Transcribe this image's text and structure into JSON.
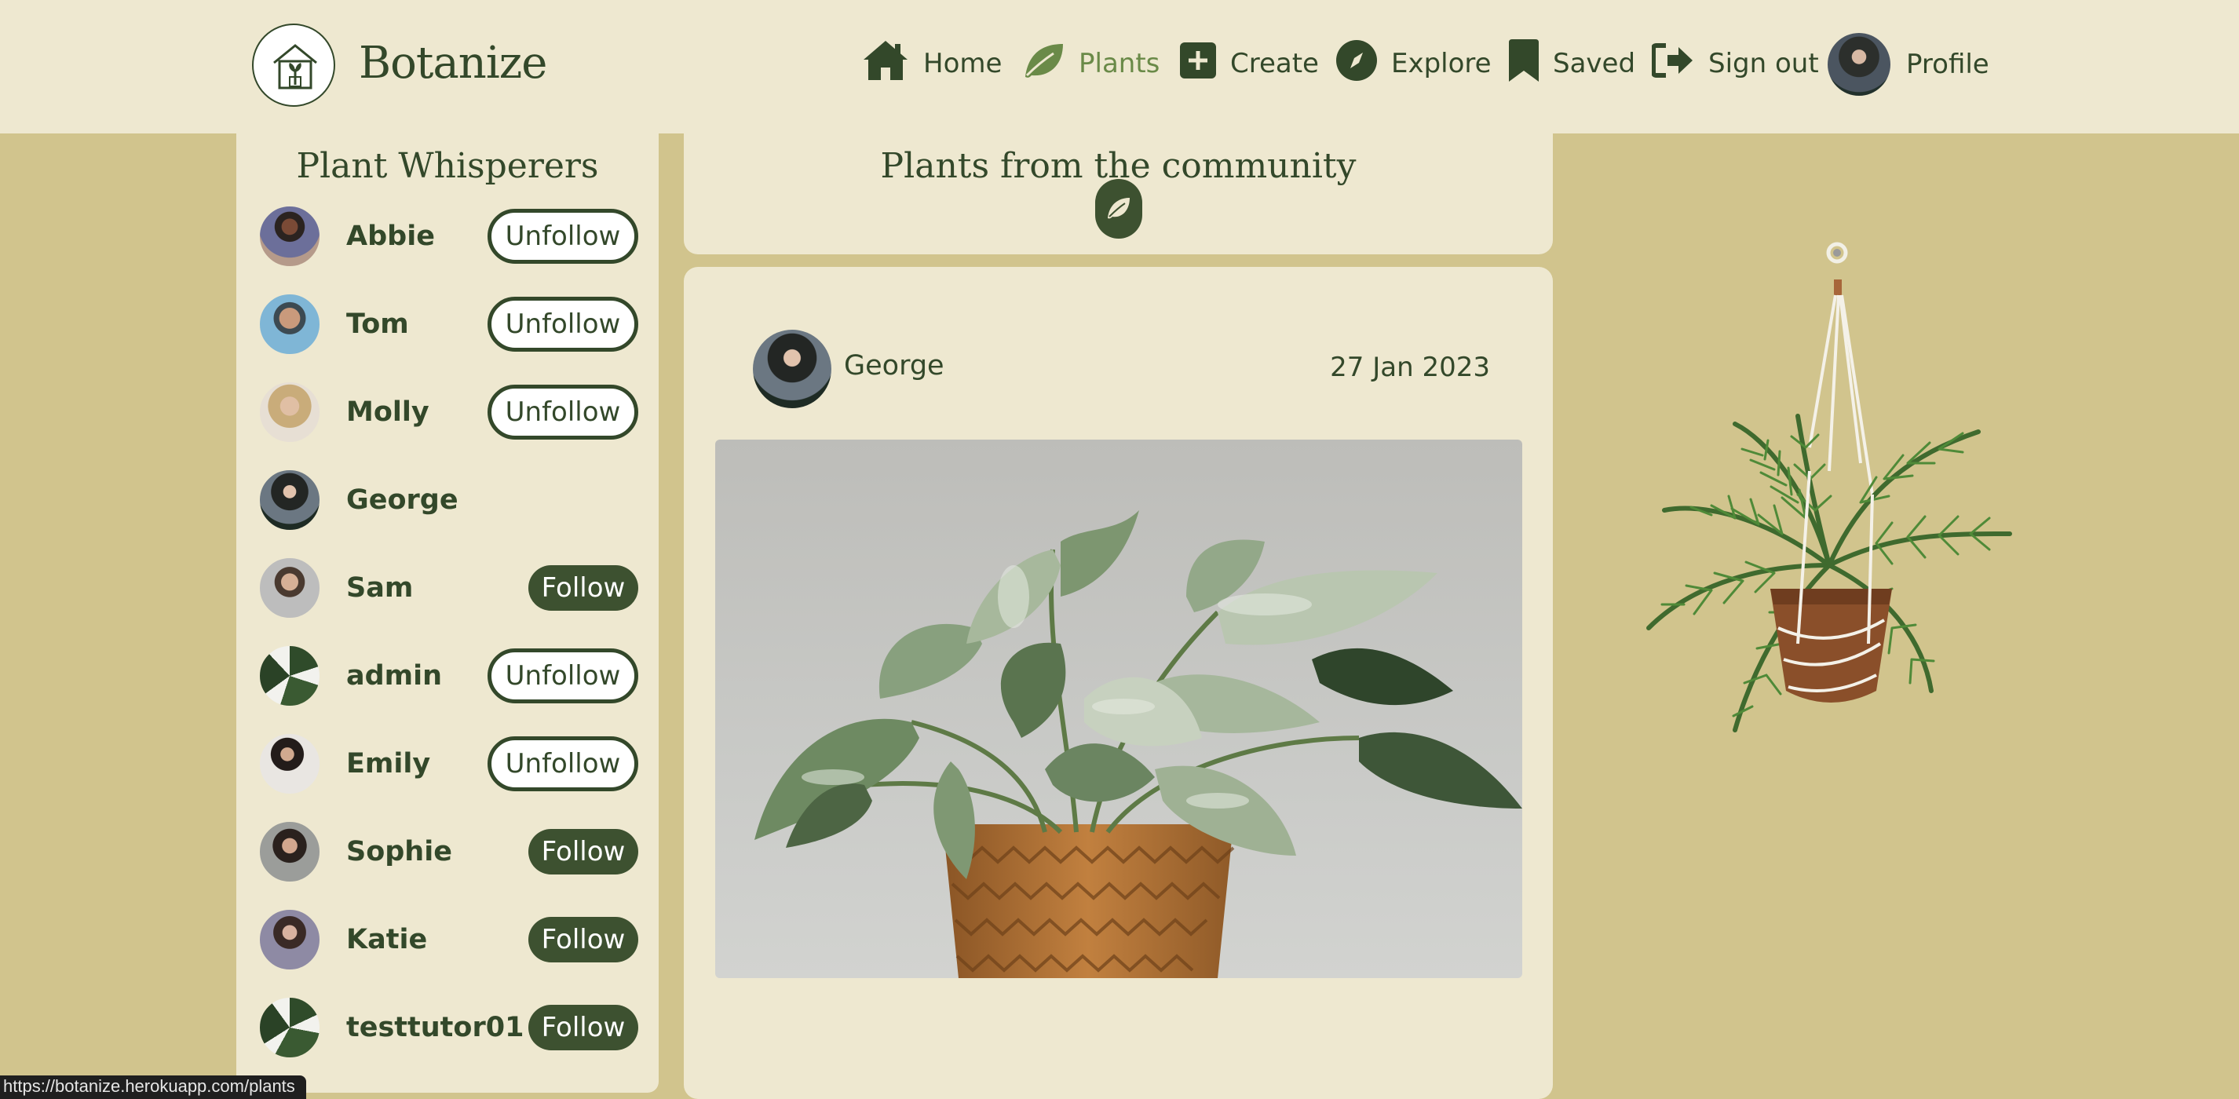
{
  "brand": {
    "name": "Botanize",
    "logo_icon": "house-sprout-icon"
  },
  "nav": {
    "items": [
      {
        "label": "Home",
        "icon": "home-icon"
      },
      {
        "label": "Plants",
        "icon": "leaf-icon",
        "active": true
      },
      {
        "label": "Create",
        "icon": "plus-square-icon"
      },
      {
        "label": "Explore",
        "icon": "compass-icon"
      },
      {
        "label": "Saved",
        "icon": "bookmark-icon"
      },
      {
        "label": "Sign out",
        "icon": "sign-out-icon"
      },
      {
        "label": "Profile",
        "icon": "avatar"
      }
    ]
  },
  "sidebar": {
    "title": "Plant Whisperers",
    "users": [
      {
        "name": "Abbie",
        "action": "Unfollow"
      },
      {
        "name": "Tom",
        "action": "Unfollow"
      },
      {
        "name": "Molly",
        "action": "Unfollow"
      },
      {
        "name": "George",
        "action": ""
      },
      {
        "name": "Sam",
        "action": "Follow"
      },
      {
        "name": "admin",
        "action": "Unfollow"
      },
      {
        "name": "Emily",
        "action": "Unfollow"
      },
      {
        "name": "Sophie",
        "action": "Follow"
      },
      {
        "name": "Katie",
        "action": "Follow"
      },
      {
        "name": "testtutor01",
        "action": "Follow"
      }
    ]
  },
  "feed": {
    "title": "Plants from the community",
    "badge_icon": "leaf-icon",
    "post": {
      "author": "George",
      "date": "27 Jan 2023",
      "image": "potted-pothos-plant-photo"
    }
  },
  "status_url": "https://botanize.herokuapp.com/plants",
  "colors": {
    "background": "#d1c48d",
    "panel": "#eee8d0",
    "primary": "#33482a",
    "button_dark": "#3d5130",
    "active_nav": "#6a8a48"
  }
}
